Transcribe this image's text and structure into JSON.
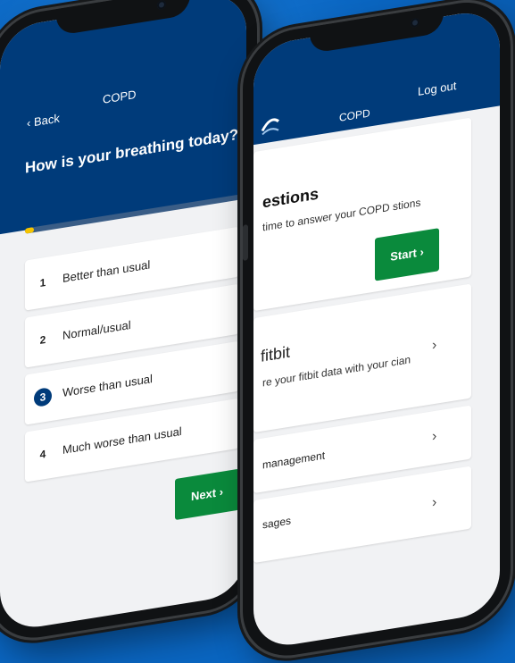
{
  "colors": {
    "background": "#0a66c2",
    "header": "#003b7a",
    "accent_green": "#0a8a3c",
    "progress": "#f5c400"
  },
  "left_phone": {
    "back_label": "‹ Back",
    "title": "COPD",
    "question": "How is your breathing today?",
    "progress_fraction": 0.04,
    "options": [
      {
        "num": "1",
        "label": "Better than usual",
        "selected": false
      },
      {
        "num": "2",
        "label": "Normal/usual",
        "selected": false
      },
      {
        "num": "3",
        "label": "Worse than usual",
        "selected": true
      },
      {
        "num": "4",
        "label": "Much worse than usual",
        "selected": false
      }
    ],
    "next_label": "Next ›"
  },
  "right_phone": {
    "title": "COPD",
    "logout_label": "Log out",
    "questions_card": {
      "title": "estions",
      "subtitle": "time to answer your COPD stions",
      "start_label": "Start ›"
    },
    "fitbit_card": {
      "title": "fitbit",
      "subtitle": "re your fitbit data with your cian",
      "chevron": "›"
    },
    "management_row": {
      "label": "management",
      "chevron": "›"
    },
    "messages_row": {
      "label": "sages",
      "chevron": "›"
    }
  }
}
